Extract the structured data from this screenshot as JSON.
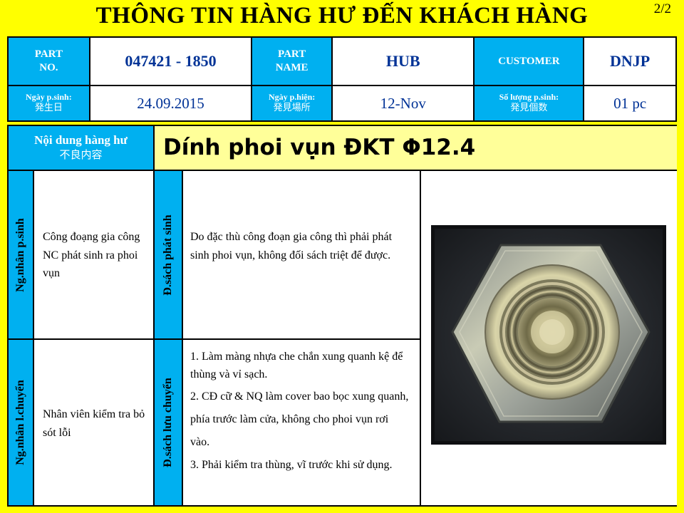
{
  "title": "THÔNG TIN HÀNG HƯ ĐẾN KHÁCH HÀNG",
  "page_number": "2/2",
  "header": {
    "part_no_label": [
      "PART",
      "NO."
    ],
    "part_no_value": "047421 - 1850",
    "part_name_label": [
      "PART",
      "NAME"
    ],
    "part_name_value": "HUB",
    "customer_label": "CUSTOMER",
    "customer_value": "DNJP",
    "date_occur_label": "Ngày p.sinh:",
    "date_occur_label_jp": "発生日",
    "date_occur_value": "24.09.2015",
    "date_found_label": "Ngày p.hiện:",
    "date_found_label_jp": "発見場所",
    "date_found_value": "12-Nov",
    "qty_label": "Số lượng p.sinh:",
    "qty_label_jp": "発見個数",
    "qty_value": "01 pc"
  },
  "defect": {
    "label": "Nội dung hàng hư",
    "label_jp": "不良内容",
    "value": "Dính phoi vụn ĐKT Φ12.4"
  },
  "analysis": {
    "cause_occur_label": "Ng.nhân p.sinh",
    "cause_occur_text": "Công đoạng gia công NC phát sinh ra phoi vụn",
    "counter_occur_label": "Đ.sách phát sinh",
    "counter_occur_text": "Do đặc thù công đoạn gia công thì phải phát sinh phoi vụn, không đối sách triệt để được.",
    "cause_outflow_label": "Ng.nhân l.chuyển",
    "cause_outflow_text": "Nhân viên kiểm tra bỏ sót lỗi",
    "counter_outflow_label": "Đ.sách lưu chuyển",
    "counter_outflow_items": [
      "1. Làm màng nhựa che chắn xung quanh kệ để thùng và vỉ sạch.",
      "2. CĐ cữ & NQ làm cover bao bọc xung quanh, phía trước làm cửa, không cho phoi vụn rơi vào.",
      "3. Phải kiểm tra thùng, vĩ trước khi sử dụng."
    ]
  }
}
